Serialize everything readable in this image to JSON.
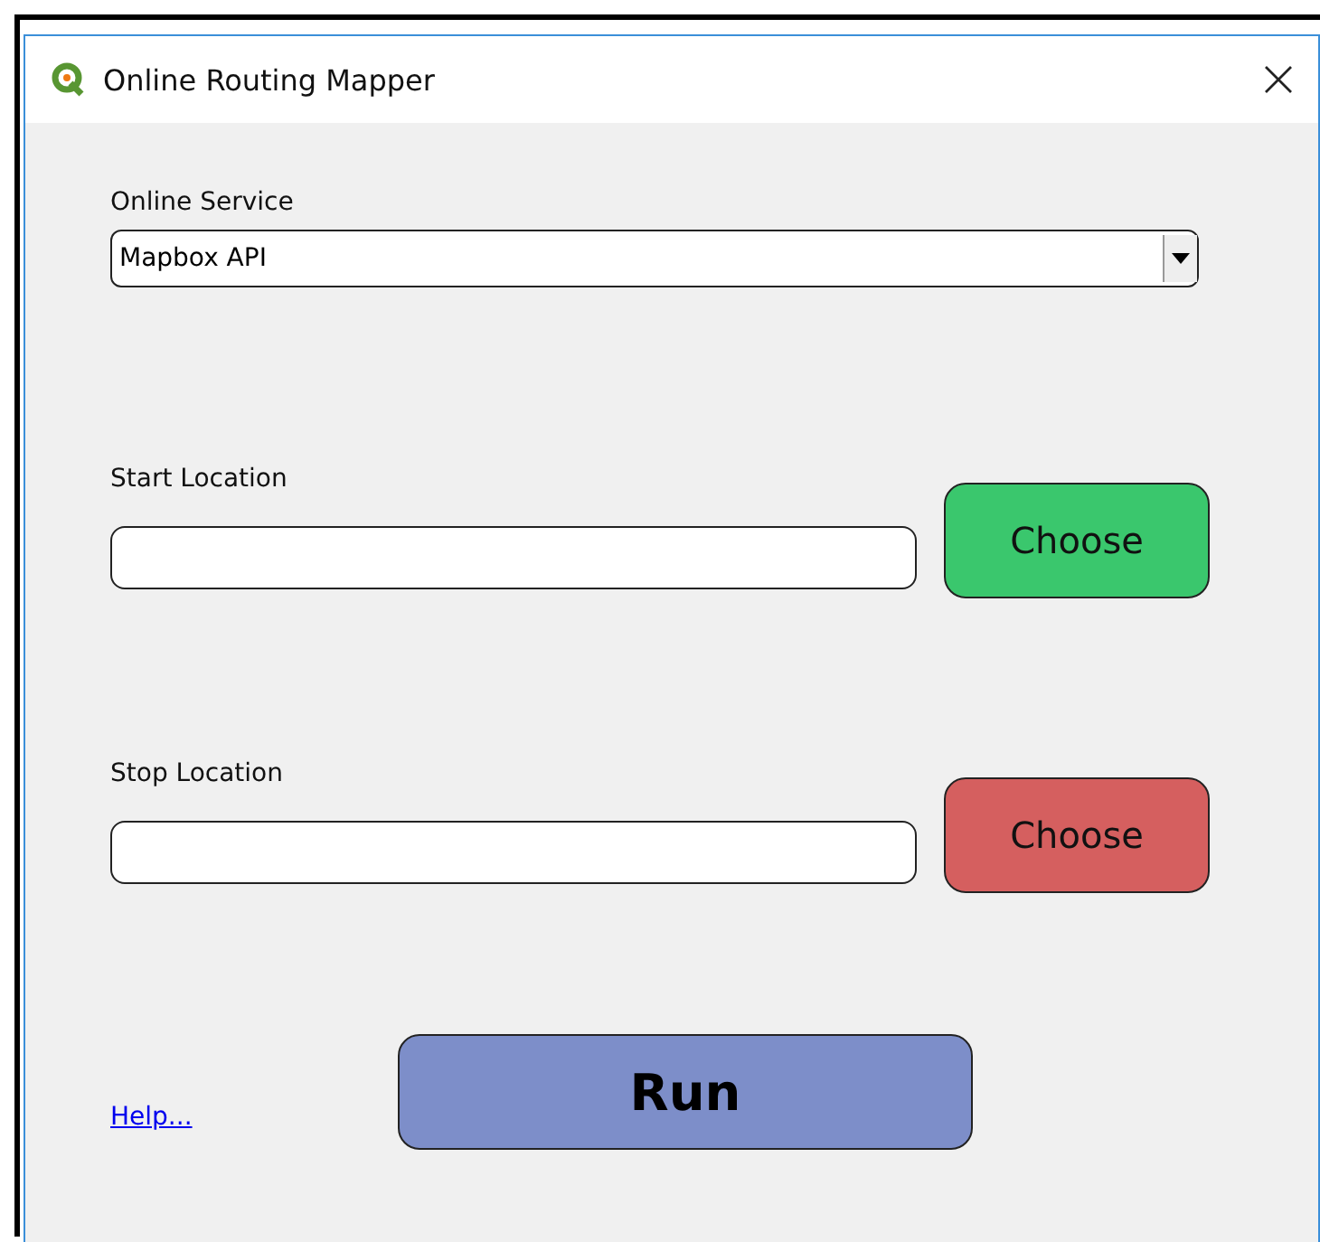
{
  "window": {
    "title": "Online Routing Mapper"
  },
  "service": {
    "label": "Online Service",
    "value": "Mapbox API"
  },
  "locations": [
    {
      "label": "Start Location",
      "button": "Choose",
      "color": "#3ac76d"
    },
    {
      "label": "Stop Location",
      "button": "Choose",
      "color": "#d55f5f"
    }
  ],
  "help_link": "Help...",
  "run_button": "Run"
}
